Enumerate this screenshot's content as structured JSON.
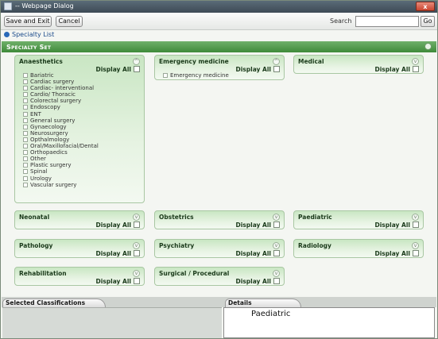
{
  "window": {
    "title": "-- Webpage Dialog",
    "close_label": "x"
  },
  "toolbar": {
    "save_exit_label": "Save and Exit",
    "cancel_label": "Cancel",
    "search_label": "Search",
    "search_value": "",
    "go_label": "Go"
  },
  "breadcrumb": {
    "label": "Specialty List"
  },
  "specialty_set": {
    "label": "Specialty Set"
  },
  "panels": {
    "anaesthetics": {
      "title": "Anaesthetics",
      "display_all": "Display All",
      "items": [
        "Bariatric",
        "Cardiac surgery",
        "Cardiac- interventional",
        "Cardio/ Thoracic",
        "Colorectal surgery",
        "Endoscopy",
        "ENT",
        "General surgery",
        "Gynaecology",
        "Neurosurgery",
        "Opthalmology",
        "Oral/Maxillofacial/Dental",
        "Orthopaedics",
        "Other",
        "Plastic surgery",
        "Spinal",
        "Urology",
        "Vascular surgery"
      ]
    },
    "emergency": {
      "title": "Emergency medicine",
      "display_all": "Display All",
      "items": [
        "Emergency medicine"
      ]
    },
    "medical": {
      "title": "Medical",
      "display_all": "Display All"
    },
    "neonatal": {
      "title": "Neonatal",
      "display_all": "Display All"
    },
    "obstetrics": {
      "title": "Obstetrics",
      "display_all": "Display All"
    },
    "paediatric": {
      "title": "Paediatric",
      "display_all": "Display All"
    },
    "pathology": {
      "title": "Pathology",
      "display_all": "Display All"
    },
    "psychiatry": {
      "title": "Psychiatry",
      "display_all": "Display All"
    },
    "radiology": {
      "title": "Radiology",
      "display_all": "Display All"
    },
    "rehabilitation": {
      "title": "Rehabilitation",
      "display_all": "Display All"
    },
    "surgical": {
      "title": "Surgical / Procedural",
      "display_all": "Display All"
    }
  },
  "tabs": {
    "selected_label": "Selected Classifications",
    "details_label": "Details"
  },
  "details": {
    "text": "Paediatric"
  },
  "colors": {
    "accent_green": "#3f8a3a",
    "panel_green": "#c9e6c3"
  }
}
